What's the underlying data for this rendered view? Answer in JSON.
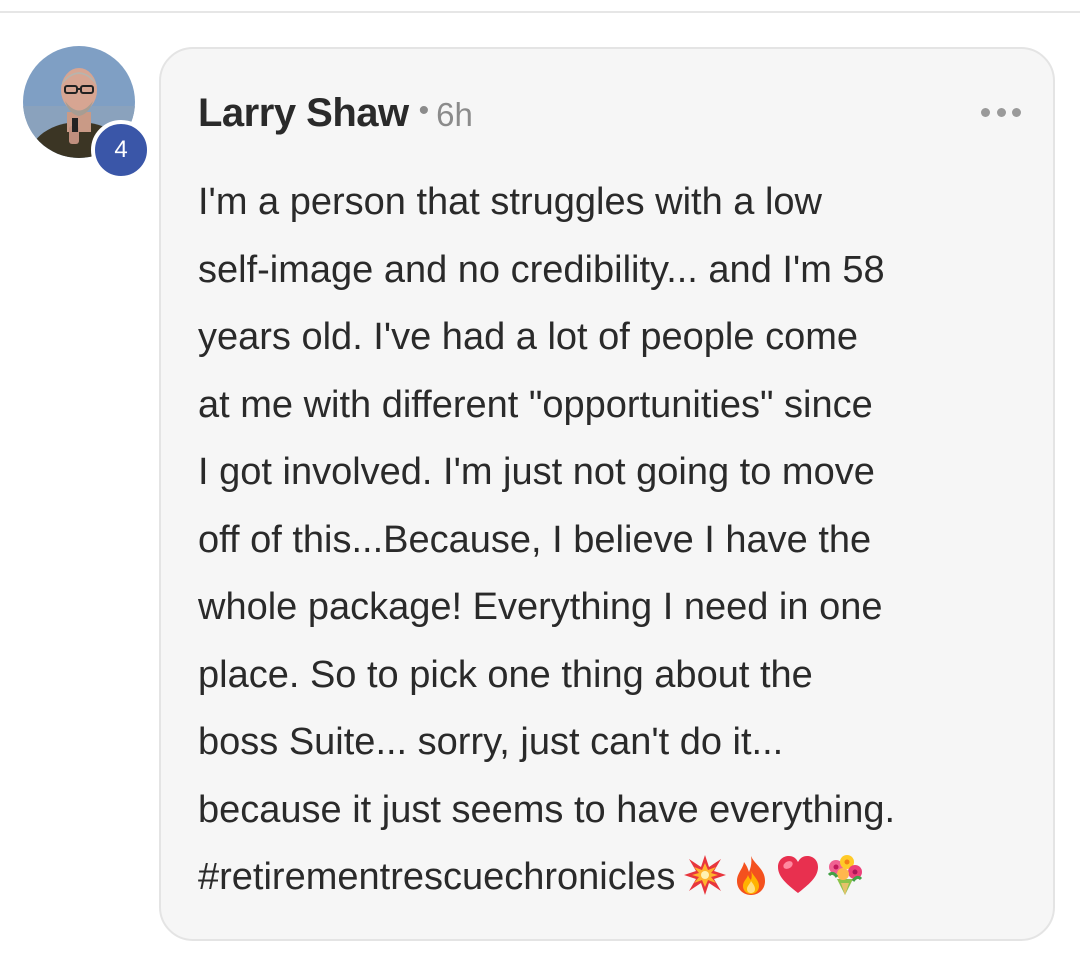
{
  "comment": {
    "author": "Larry Shaw",
    "separator": "•",
    "timestamp": "6h",
    "level_badge": "4",
    "body": "I'm a person that struggles with a low\nself-image and no credibility... and I'm 58\nyears old. I've had a lot of people come\nat me with different \"opportunities\" since\nI got involved. I'm just not going to move\noff of this...Because, I believe I have the\nwhole package! Everything I need in one\nplace. So to pick one thing about the\nboss Suite... sorry, just can't do it...\nbecause it just seems to have everything.",
    "hashtag": "#retirementrescuechronicles",
    "emojis": [
      "collision-emoji",
      "fire-emoji",
      "red-heart-emoji",
      "bouquet-emoji"
    ],
    "more_icon": "more-horizontal-icon"
  },
  "colors": {
    "badge": "#3a56a8",
    "bubble_bg": "#f6f6f6",
    "text": "#2a2a2a",
    "muted": "#8b8b8b"
  }
}
